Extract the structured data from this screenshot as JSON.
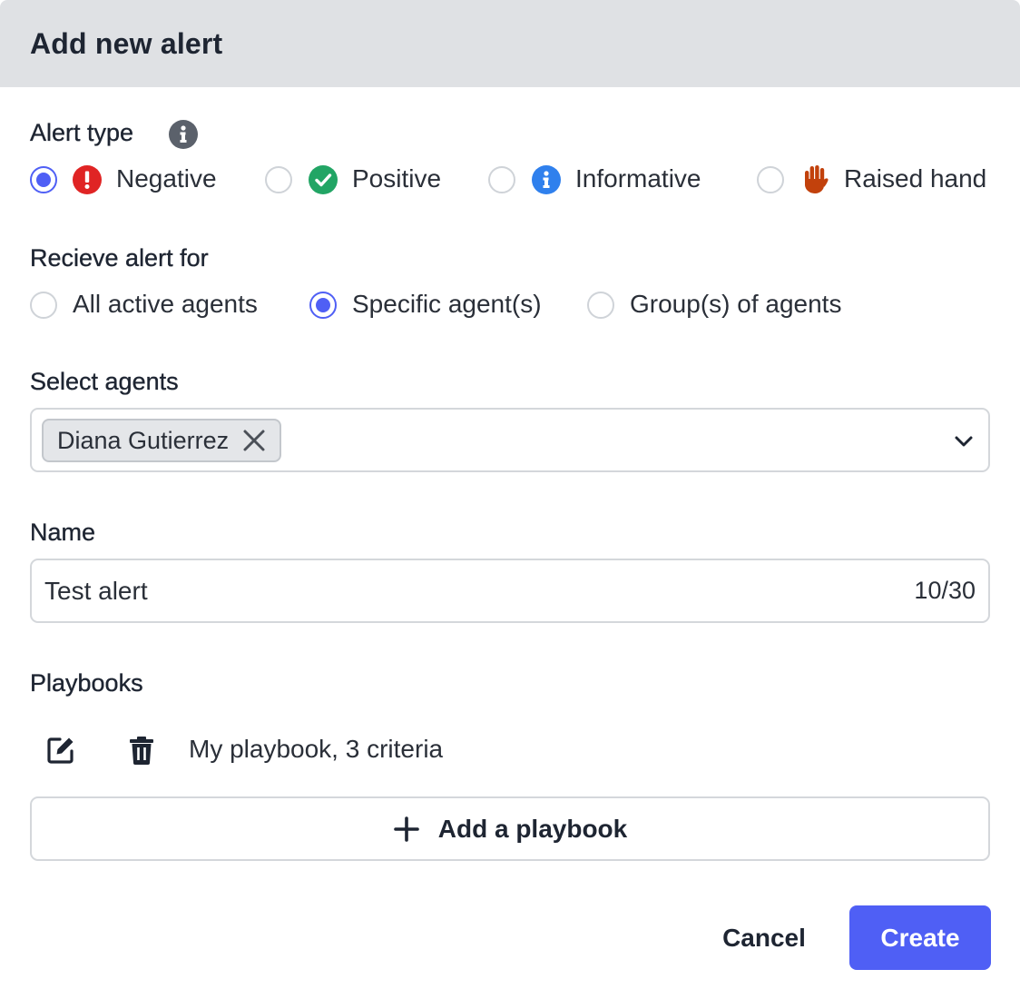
{
  "dialog": {
    "title": "Add new alert"
  },
  "alert_type": {
    "label": "Alert type",
    "info_icon": "info-circle-icon",
    "options": [
      {
        "label": "Negative",
        "icon": "exclamation-circle-icon",
        "color": "#e02424",
        "selected": true
      },
      {
        "label": "Positive",
        "icon": "check-circle-icon",
        "color": "#22a565",
        "selected": false
      },
      {
        "label": "Informative",
        "icon": "info-circle-icon",
        "color": "#2f80ed",
        "selected": false
      },
      {
        "label": "Raised hand",
        "icon": "raised-hand-icon",
        "color": "#c2410c",
        "selected": false
      }
    ]
  },
  "receive_for": {
    "label": "Recieve alert for",
    "options": [
      {
        "label": "All active agents",
        "selected": false
      },
      {
        "label": "Specific agent(s)",
        "selected": true
      },
      {
        "label": "Group(s) of agents",
        "selected": false
      }
    ]
  },
  "select_agents": {
    "label": "Select agents",
    "chips": [
      "Diana Gutierrez"
    ],
    "dropdown_icon": "chevron-down-icon"
  },
  "name": {
    "label": "Name",
    "value": "Test alert",
    "counter": "10/30"
  },
  "playbooks": {
    "label": "Playbooks",
    "items": [
      {
        "text": "My playbook, 3 criteria"
      }
    ],
    "add_label": "Add a playbook"
  },
  "actions": {
    "cancel_label": "Cancel",
    "create_label": "Create"
  },
  "colors": {
    "accent": "#4f5ff5",
    "header_bg": "#dfe1e4",
    "text": "#1e2532"
  }
}
